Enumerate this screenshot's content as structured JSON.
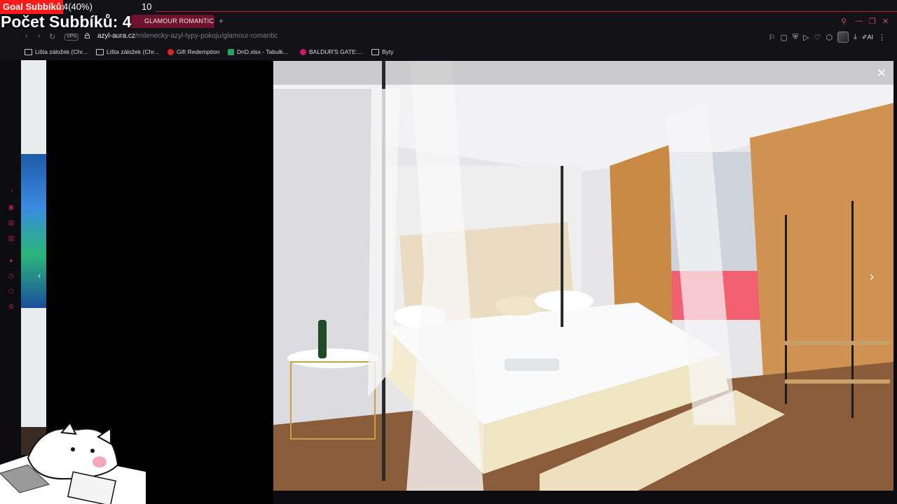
{
  "overlay": {
    "goal_label": "Goal Subbíků:",
    "goal_value": "4(40%)",
    "goal_target": "10",
    "sub_count": "Počet Subbíků: 4"
  },
  "browser": {
    "tab_title": "GLAMOUR ROMANTIC",
    "new_tab": "+",
    "vpn_badge": "VPN",
    "url_host": "azyl-aura.cz",
    "url_path": "/milenecky-azyl-typy-pokoju/glamour-romantic",
    "ai_label": "AI",
    "accent_color": "#b0214a"
  },
  "bookmarks": [
    {
      "label": "Lišta záložek (Chr...",
      "icon": "folder-icon"
    },
    {
      "label": "Lišta záložek (Chr...",
      "icon": "folder-icon"
    },
    {
      "label": "Gift Redemption",
      "icon": "gift-redemption-icon"
    },
    {
      "label": "DnD.xlsx - Tabulk...",
      "icon": "sheets-icon"
    },
    {
      "label": "BALDUR'S GATE:...",
      "icon": "baldurs-gate-icon"
    },
    {
      "label": "Byty",
      "icon": "folder-icon"
    }
  ],
  "gallery": {
    "image_subject": "hotel room with canopy bed",
    "close_icon": "close-icon",
    "next_icon": "chevron-right-icon"
  }
}
